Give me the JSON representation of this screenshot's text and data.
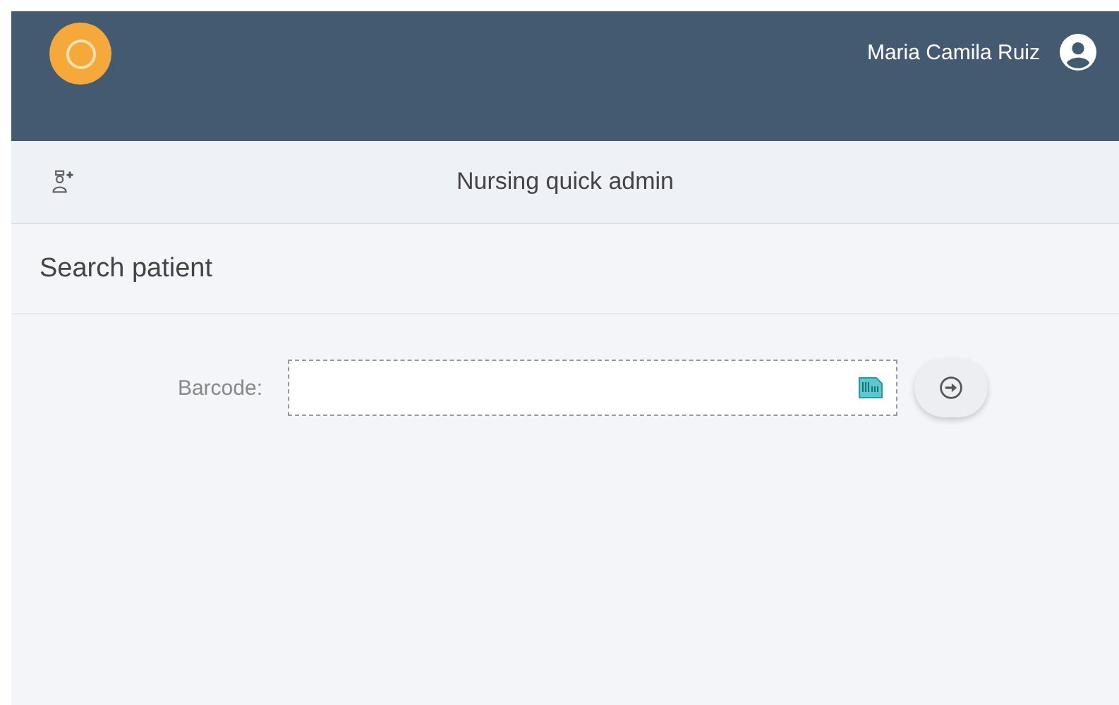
{
  "header": {
    "user_name": "Maria Camila Ruiz"
  },
  "toolbar": {
    "title": "Nursing quick admin"
  },
  "section": {
    "title": "Search patient"
  },
  "form": {
    "label": "Barcode:"
  }
}
